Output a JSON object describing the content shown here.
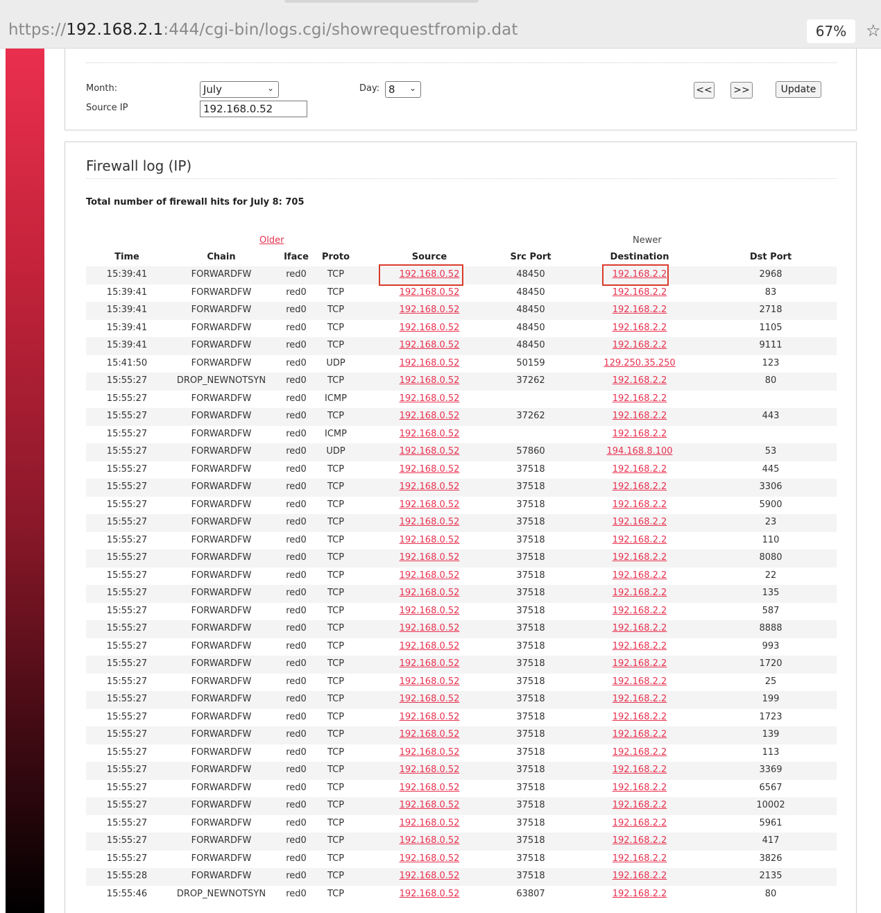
{
  "browser": {
    "url_scheme": "https://",
    "url_host": "192.168.2.1",
    "url_rest": ":444/cgi-bin/logs.cgi/showrequestfromip.dat",
    "zoom": "67%",
    "star_icon": "star-icon"
  },
  "filter": {
    "month_label": "Month:",
    "month_value": "July",
    "day_label": "Day:",
    "day_value": "8",
    "source_ip_label": "Source IP",
    "source_ip_value": "192.168.0.52",
    "prev_label": "<<",
    "next_label": ">>",
    "update_label": "Update"
  },
  "log": {
    "title": "Firewall log (IP)",
    "total": "Total number of firewall hits for July 8: 705",
    "older": "Older",
    "newer": "Newer",
    "headers": {
      "time": "Time",
      "chain": "Chain",
      "iface": "Iface",
      "proto": "Proto",
      "source": "Source",
      "src_port": "Src Port",
      "destination": "Destination",
      "dst_port": "Dst Port"
    },
    "rows": [
      [
        "15:39:41",
        "FORWARDFW",
        "red0",
        "TCP",
        "192.168.0.52",
        "48450",
        "192.168.2.2",
        "2968"
      ],
      [
        "15:39:41",
        "FORWARDFW",
        "red0",
        "TCP",
        "192.168.0.52",
        "48450",
        "192.168.2.2",
        "83"
      ],
      [
        "15:39:41",
        "FORWARDFW",
        "red0",
        "TCP",
        "192.168.0.52",
        "48450",
        "192.168.2.2",
        "2718"
      ],
      [
        "15:39:41",
        "FORWARDFW",
        "red0",
        "TCP",
        "192.168.0.52",
        "48450",
        "192.168.2.2",
        "1105"
      ],
      [
        "15:39:41",
        "FORWARDFW",
        "red0",
        "TCP",
        "192.168.0.52",
        "48450",
        "192.168.2.2",
        "9111"
      ],
      [
        "15:41:50",
        "FORWARDFW",
        "red0",
        "UDP",
        "192.168.0.52",
        "50159",
        "129.250.35.250",
        "123"
      ],
      [
        "15:55:27",
        "DROP_NEWNOTSYN",
        "red0",
        "TCP",
        "192.168.0.52",
        "37262",
        "192.168.2.2",
        "80"
      ],
      [
        "15:55:27",
        "FORWARDFW",
        "red0",
        "ICMP",
        "192.168.0.52",
        "",
        "192.168.2.2",
        ""
      ],
      [
        "15:55:27",
        "FORWARDFW",
        "red0",
        "TCP",
        "192.168.0.52",
        "37262",
        "192.168.2.2",
        "443"
      ],
      [
        "15:55:27",
        "FORWARDFW",
        "red0",
        "ICMP",
        "192.168.0.52",
        "",
        "192.168.2.2",
        ""
      ],
      [
        "15:55:27",
        "FORWARDFW",
        "red0",
        "UDP",
        "192.168.0.52",
        "57860",
        "194.168.8.100",
        "53"
      ],
      [
        "15:55:27",
        "FORWARDFW",
        "red0",
        "TCP",
        "192.168.0.52",
        "37518",
        "192.168.2.2",
        "445"
      ],
      [
        "15:55:27",
        "FORWARDFW",
        "red0",
        "TCP",
        "192.168.0.52",
        "37518",
        "192.168.2.2",
        "3306"
      ],
      [
        "15:55:27",
        "FORWARDFW",
        "red0",
        "TCP",
        "192.168.0.52",
        "37518",
        "192.168.2.2",
        "5900"
      ],
      [
        "15:55:27",
        "FORWARDFW",
        "red0",
        "TCP",
        "192.168.0.52",
        "37518",
        "192.168.2.2",
        "23"
      ],
      [
        "15:55:27",
        "FORWARDFW",
        "red0",
        "TCP",
        "192.168.0.52",
        "37518",
        "192.168.2.2",
        "110"
      ],
      [
        "15:55:27",
        "FORWARDFW",
        "red0",
        "TCP",
        "192.168.0.52",
        "37518",
        "192.168.2.2",
        "8080"
      ],
      [
        "15:55:27",
        "FORWARDFW",
        "red0",
        "TCP",
        "192.168.0.52",
        "37518",
        "192.168.2.2",
        "22"
      ],
      [
        "15:55:27",
        "FORWARDFW",
        "red0",
        "TCP",
        "192.168.0.52",
        "37518",
        "192.168.2.2",
        "135"
      ],
      [
        "15:55:27",
        "FORWARDFW",
        "red0",
        "TCP",
        "192.168.0.52",
        "37518",
        "192.168.2.2",
        "587"
      ],
      [
        "15:55:27",
        "FORWARDFW",
        "red0",
        "TCP",
        "192.168.0.52",
        "37518",
        "192.168.2.2",
        "8888"
      ],
      [
        "15:55:27",
        "FORWARDFW",
        "red0",
        "TCP",
        "192.168.0.52",
        "37518",
        "192.168.2.2",
        "993"
      ],
      [
        "15:55:27",
        "FORWARDFW",
        "red0",
        "TCP",
        "192.168.0.52",
        "37518",
        "192.168.2.2",
        "1720"
      ],
      [
        "15:55:27",
        "FORWARDFW",
        "red0",
        "TCP",
        "192.168.0.52",
        "37518",
        "192.168.2.2",
        "25"
      ],
      [
        "15:55:27",
        "FORWARDFW",
        "red0",
        "TCP",
        "192.168.0.52",
        "37518",
        "192.168.2.2",
        "199"
      ],
      [
        "15:55:27",
        "FORWARDFW",
        "red0",
        "TCP",
        "192.168.0.52",
        "37518",
        "192.168.2.2",
        "1723"
      ],
      [
        "15:55:27",
        "FORWARDFW",
        "red0",
        "TCP",
        "192.168.0.52",
        "37518",
        "192.168.2.2",
        "139"
      ],
      [
        "15:55:27",
        "FORWARDFW",
        "red0",
        "TCP",
        "192.168.0.52",
        "37518",
        "192.168.2.2",
        "113"
      ],
      [
        "15:55:27",
        "FORWARDFW",
        "red0",
        "TCP",
        "192.168.0.52",
        "37518",
        "192.168.2.2",
        "3369"
      ],
      [
        "15:55:27",
        "FORWARDFW",
        "red0",
        "TCP",
        "192.168.0.52",
        "37518",
        "192.168.2.2",
        "6567"
      ],
      [
        "15:55:27",
        "FORWARDFW",
        "red0",
        "TCP",
        "192.168.0.52",
        "37518",
        "192.168.2.2",
        "10002"
      ],
      [
        "15:55:27",
        "FORWARDFW",
        "red0",
        "TCP",
        "192.168.0.52",
        "37518",
        "192.168.2.2",
        "5961"
      ],
      [
        "15:55:27",
        "FORWARDFW",
        "red0",
        "TCP",
        "192.168.0.52",
        "37518",
        "192.168.2.2",
        "417"
      ],
      [
        "15:55:27",
        "FORWARDFW",
        "red0",
        "TCP",
        "192.168.0.52",
        "37518",
        "192.168.2.2",
        "3826"
      ],
      [
        "15:55:28",
        "FORWARDFW",
        "red0",
        "TCP",
        "192.168.0.52",
        "37518",
        "192.168.2.2",
        "2135"
      ],
      [
        "15:55:46",
        "DROP_NEWNOTSYN",
        "red0",
        "TCP",
        "192.168.0.52",
        "63807",
        "192.168.2.2",
        "80"
      ]
    ]
  },
  "colors": {
    "link": "#e8314f",
    "highlight_box": "#d93a2b",
    "sidebar_top": "#ea2f4e",
    "sidebar_bottom": "#000000"
  }
}
